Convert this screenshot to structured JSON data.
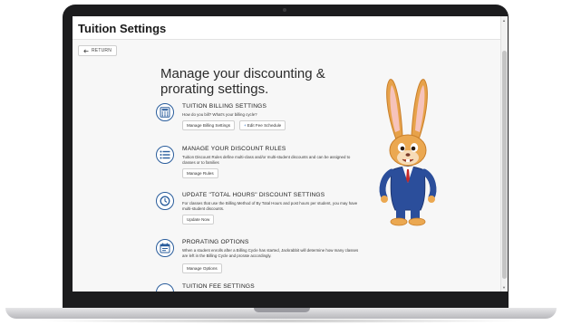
{
  "app": {
    "title": "Tuition Settings"
  },
  "nav": {
    "return_label": "RETURN"
  },
  "page": {
    "heading": "Manage your discounting & prorating settings."
  },
  "sections": [
    {
      "title": "TUITION BILLING SETTINGS",
      "description": "How do you bill? What's your billing cycle?",
      "icon": "calculator-icon",
      "buttons": [
        "Manage Billing Settings",
        "Edit Fee Schedule"
      ]
    },
    {
      "title": "MANAGE YOUR DISCOUNT RULES",
      "description": "Tuition Discount Rules define multi-class and/or multi-student discounts and can be assigned to classes or to families",
      "icon": "list-icon",
      "buttons": [
        "Manage Rules"
      ]
    },
    {
      "title": "UPDATE \"TOTAL HOURS\" DISCOUNT SETTINGS",
      "description": "For classes that use the Billing Method of By Total Hours and post hours per student, you may have multi-student discounts.",
      "icon": "clock-icon",
      "buttons": [
        "Update Now"
      ]
    },
    {
      "title": "PRORATING OPTIONS",
      "description": "When a student enrolls after a Billing Cycle has started, Jackrabbit will determine how many classes are left in the Billing Cycle and prorate accordingly.",
      "icon": "calendar-icon",
      "buttons": [
        "Manage Options"
      ]
    },
    {
      "title": "TUITION FEE SETTINGS",
      "description": "",
      "icon": "dollar-icon",
      "buttons": []
    }
  ],
  "colors": {
    "accent": "#2a5d9c",
    "link": "#2a6bbd",
    "background": "#f7f7f7"
  },
  "icons": {
    "return": "arrow-left-icon",
    "scroll_up": "chevron-up-icon",
    "scroll_down": "chevron-down-icon",
    "mascot": "rabbit-mascot"
  }
}
